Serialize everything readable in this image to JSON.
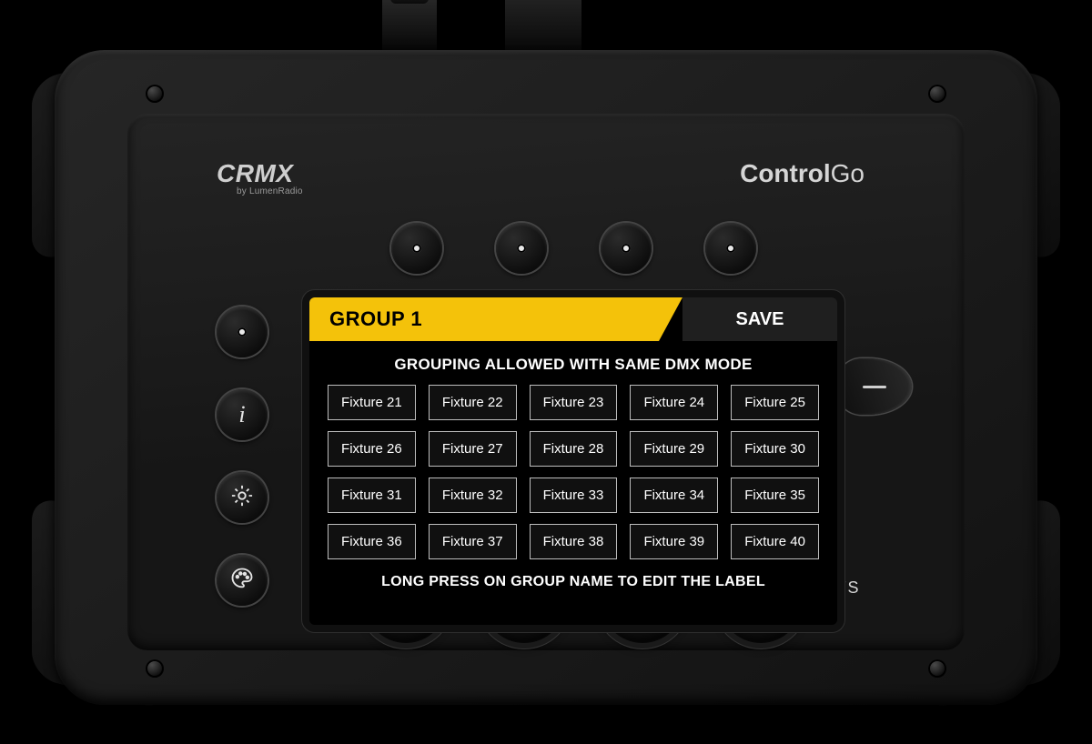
{
  "branding": {
    "crmx_main": "CRMX",
    "crmx_sub": "by LumenRadio",
    "product_bold": "Control",
    "product_light": "Go",
    "prolights": "PROLiGHTS"
  },
  "screen": {
    "title": "GROUP 1",
    "save_label": "SAVE",
    "subtitle": "GROUPING ALLOWED WITH SAME DMX MODE",
    "footer": "LONG PRESS ON GROUP NAME TO EDIT THE LABEL",
    "fixtures": [
      "Fixture 21",
      "Fixture 22",
      "Fixture 23",
      "Fixture 24",
      "Fixture 25",
      "Fixture 26",
      "Fixture 27",
      "Fixture 28",
      "Fixture 29",
      "Fixture 30",
      "Fixture 31",
      "Fixture 32",
      "Fixture 33",
      "Fixture 34",
      "Fixture 35",
      "Fixture 36",
      "Fixture 37",
      "Fixture 38",
      "Fixture 39",
      "Fixture 40"
    ]
  },
  "colors": {
    "accent": "#f4c20a"
  },
  "icons": {
    "side": [
      "dot",
      "info",
      "settings",
      "palette"
    ]
  }
}
